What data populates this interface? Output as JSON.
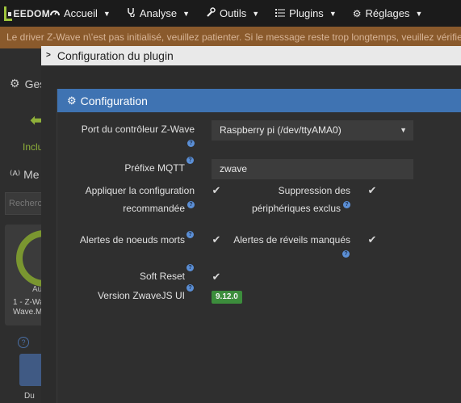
{
  "navbar": {
    "logo_text": "EEDOM",
    "items": [
      {
        "label": "Accueil",
        "icon": "dashboard-icon"
      },
      {
        "label": "Analyse",
        "icon": "stethoscope-icon"
      },
      {
        "label": "Outils",
        "icon": "wrench-icon"
      },
      {
        "label": "Plugins",
        "icon": "list-icon"
      },
      {
        "label": "Réglages",
        "icon": "gear-icon"
      }
    ]
  },
  "warning": {
    "text": "Le driver Z-Wave n\\'est pas initialisé, veuillez patienter. Si le message reste trop longtemps, veuillez vérifier la co"
  },
  "background": {
    "gest_label": "Ges",
    "inclusion_label": "Inclu",
    "mes_label": "Me",
    "search_placeholder": "Recherc",
    "card_status": "Au",
    "card_name_1": "1 - Z-Wa",
    "card_name_2": "Wave.Me",
    "device_tag": "Du"
  },
  "modal": {
    "title": "Configuration du plugin"
  },
  "panel": {
    "title": "Configuration",
    "accent_color": "#3f73b2",
    "port_label": "Port du contrôleur Z-Wave",
    "port_value": "Raspberry pi (/dev/ttyAMA0)",
    "mqtt_label": "Préfixe MQTT",
    "mqtt_value": "zwave",
    "apply_label_1": "Appliquer la configuration",
    "apply_label_2": "recommandée",
    "apply_checked": true,
    "suppress_label_1": "Suppression des",
    "suppress_label_2": "périphériques exclus",
    "suppress_checked": true,
    "dead_label": "Alertes de noeuds morts",
    "dead_checked": true,
    "wake_label": "Alertes de réveils manqués",
    "wake_checked": true,
    "soft_reset_label": "Soft Reset",
    "soft_reset_checked": true,
    "version_label": "Version ZwaveJS UI",
    "version_value": "9.12.0"
  }
}
